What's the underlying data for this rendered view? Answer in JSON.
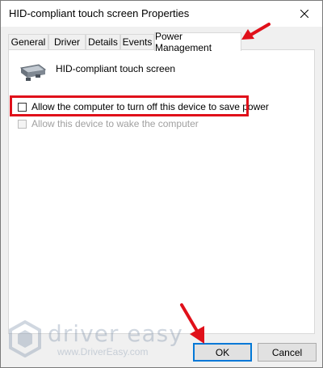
{
  "window": {
    "title": "HID-compliant touch screen Properties"
  },
  "tabs": [
    {
      "label": "General"
    },
    {
      "label": "Driver"
    },
    {
      "label": "Details"
    },
    {
      "label": "Events"
    },
    {
      "label": "Power Management",
      "active": true
    }
  ],
  "device": {
    "name": "HID-compliant touch screen",
    "icon": "touch-screen-device-icon"
  },
  "options": {
    "allow_turn_off_label": "Allow the computer to turn off this device to save power",
    "allow_turn_off_checked": false,
    "allow_wake_label": "Allow this device to wake the computer",
    "allow_wake_checked": false,
    "allow_wake_enabled": false
  },
  "buttons": {
    "ok_label": "OK",
    "cancel_label": "Cancel"
  },
  "watermark": {
    "brand": "driver easy",
    "url": "www.DriverEasy.com"
  },
  "colors": {
    "annotation_red": "#e0101a",
    "focus_blue": "#0078d7"
  }
}
